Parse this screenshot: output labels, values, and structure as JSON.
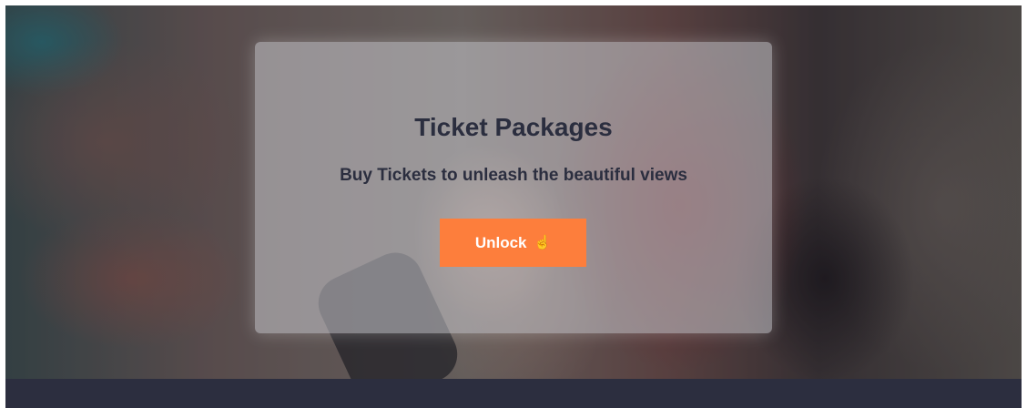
{
  "hero": {
    "title": "Ticket Packages",
    "subtitle": "Buy Tickets to unleash the beautiful views",
    "button": {
      "label": "Unlock",
      "icon": "hand-icon"
    }
  },
  "colors": {
    "accent": "#fd7e3c",
    "text_dark": "#2b2e3f",
    "footer": "#2c2e3f"
  }
}
